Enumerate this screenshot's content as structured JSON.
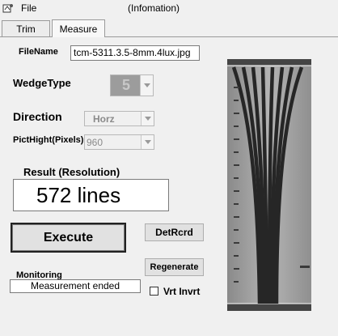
{
  "window": {
    "menu_file": "File",
    "title": "(Infomation)"
  },
  "tabs": [
    {
      "label": "Trim"
    },
    {
      "label": "Measure"
    }
  ],
  "filename": {
    "label": "FileName",
    "value": "tcm-5311.3.5-8mm.4lux.jpg"
  },
  "wedge_type": {
    "label": "WedgeType",
    "value": "5"
  },
  "direction": {
    "label": "Direction",
    "value": "Horz"
  },
  "pict_height": {
    "label": "PictHight(Pixels)",
    "value": "960"
  },
  "result": {
    "label": "Result (Resolution)",
    "value": "572 lines"
  },
  "buttons": {
    "execute": "Execute",
    "det_rcrd": "DetRcrd",
    "regenerate": "Regenerate"
  },
  "monitoring": {
    "label": "Monitoring",
    "status": "Measurement ended"
  },
  "vrt_invrt": {
    "label": "Vrt Invrt",
    "checked": false
  },
  "colors": {
    "background": "#f0f0f0",
    "image_gray": "#7d7d7d",
    "wedge_dark": "#2b2b2b"
  },
  "icons": {
    "app": "app-icon",
    "dropdown": "chevron-down-icon"
  }
}
